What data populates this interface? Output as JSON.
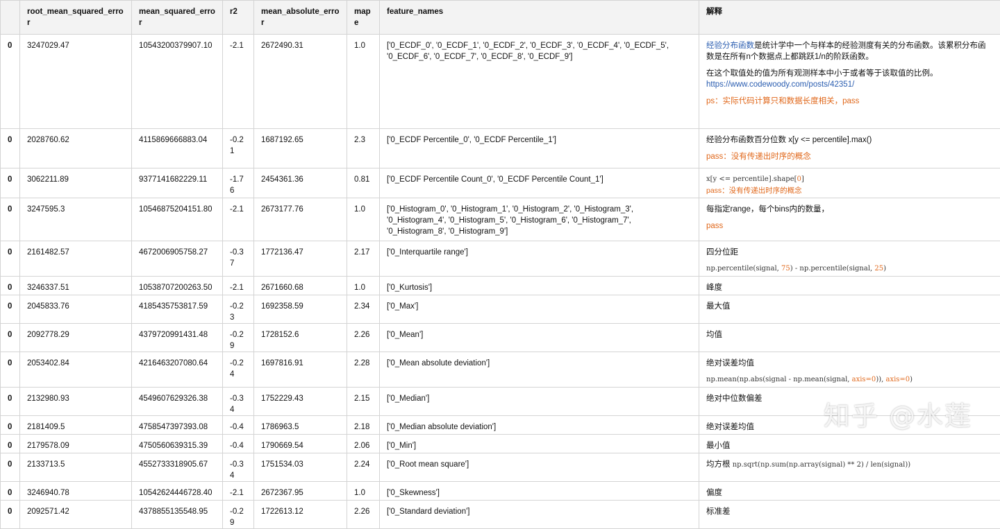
{
  "headers": [
    "",
    "root_mean_squared_error",
    "mean_squared_error",
    "r2",
    "mean_absolute_error",
    "mape",
    "feature_names",
    "解释"
  ],
  "rows": [
    {
      "idx": "0",
      "rmse": "3247029.47",
      "mse": "10543200379907.10",
      "r2": "-2.1",
      "mae": "2672490.31",
      "mape": "1.0",
      "features": "['0_ECDF_0', '0_ECDF_1', '0_ECDF_2', '0_ECDF_3', '0_ECDF_4', '0_ECDF_5', '0_ECDF_6', '0_ECDF_7', '0_ECDF_8', '0_ECDF_9']",
      "exp_link": "经验分布函数",
      "exp_a": "是统计学中一个与样本的经验测度有关的分布函数。该累积分布函数是在所有n个数据点上都跳跃1/n的阶跃函数。",
      "exp_b": "在这个取值处的值为所有观测样本中小于或者等于该取值的比例。",
      "exp_url": "https://www.codewoody.com/posts/42351/",
      "exp_ps": "ps：实际代码计算只和数据长度相关，pass"
    },
    {
      "idx": "0",
      "rmse": "2028760.62",
      "mse": "4115869666883.04",
      "r2": "-0.21",
      "mae": "1687192.65",
      "mape": "2.3",
      "features": "['0_ECDF Percentile_0', '0_ECDF Percentile_1']",
      "exp_a": "经验分布函数百分位数 x[y <= percentile].max()",
      "exp_pass": "pass：没有传递出时序的概念"
    },
    {
      "idx": "0",
      "rmse": "3062211.89",
      "mse": "9377141682229.11",
      "r2": "-1.76",
      "mae": "2454361.36",
      "mape": "0.81",
      "features": "['0_ECDF Percentile Count_0', '0_ECDF Percentile Count_1']",
      "exp_code_a": "x[y <= percentile].shape[",
      "exp_code_num": "0",
      "exp_code_b": "]",
      "exp_pass": "pass：没有传递出时序的概念"
    },
    {
      "idx": "0",
      "rmse": "3247595.3",
      "mse": "10546875204151.80",
      "r2": "-2.1",
      "mae": "2673177.76",
      "mape": "1.0",
      "features": "['0_Histogram_0', '0_Histogram_1', '0_Histogram_2', '0_Histogram_3', '0_Histogram_4', '0_Histogram_5', '0_Histogram_6', '0_Histogram_7', '0_Histogram_8', '0_Histogram_9']",
      "exp_a": "每指定range，每个bins内的数量，",
      "exp_pass": "pass"
    },
    {
      "idx": "0",
      "rmse": "2161482.57",
      "mse": "4672006905758.27",
      "r2": "-0.37",
      "mae": "1772136.47",
      "mape": "2.17",
      "features": "['0_Interquartile range']",
      "exp_a": "四分位距",
      "exp_code_a": "np.percentile(signal, ",
      "exp_code_num": "75",
      "exp_code_b": ") - np.percentile(signal, ",
      "exp_code_num2": "25",
      "exp_code_c": ")"
    },
    {
      "idx": "0",
      "rmse": "3246337.51",
      "mse": "10538707200263.50",
      "r2": "-2.1",
      "mae": "2671660.68",
      "mape": "1.0",
      "features": "['0_Kurtosis']",
      "exp_a": "峰度"
    },
    {
      "idx": "0",
      "rmse": "2045833.76",
      "mse": "4185435753817.59",
      "r2": "-0.23",
      "mae": "1692358.59",
      "mape": "2.34",
      "features": "['0_Max']",
      "exp_a": "最大值"
    },
    {
      "idx": "0",
      "rmse": "2092778.29",
      "mse": "4379720991431.48",
      "r2": "-0.29",
      "mae": "1728152.6",
      "mape": "2.26",
      "features": "['0_Mean']",
      "exp_a": "均值"
    },
    {
      "idx": "0",
      "rmse": "2053402.84",
      "mse": "4216463207080.64",
      "r2": "-0.24",
      "mae": "1697816.91",
      "mape": "2.28",
      "features": "['0_Mean absolute deviation']",
      "exp_a": "绝对误差均值",
      "exp_code_a": "np.mean(np.abs(signal - np.mean(signal, ",
      "exp_code_num": "axis=0",
      "exp_code_b": ")), ",
      "exp_code_num2": "axis=0",
      "exp_code_c": ")"
    },
    {
      "idx": "0",
      "rmse": "2132980.93",
      "mse": "4549607629326.38",
      "r2": "-0.34",
      "mae": "1752229.43",
      "mape": "2.15",
      "features": "['0_Median']",
      "exp_a": "绝对中位数偏差"
    },
    {
      "idx": "0",
      "rmse": "2181409.5",
      "mse": "4758547397393.08",
      "r2": "-0.4",
      "mae": "1786963.5",
      "mape": "2.18",
      "features": "['0_Median absolute deviation']",
      "exp_a": "绝对误差均值"
    },
    {
      "idx": "0",
      "rmse": "2179578.09",
      "mse": "4750560639315.39",
      "r2": "-0.4",
      "mae": "1790669.54",
      "mape": "2.06",
      "features": "['0_Min']",
      "exp_a": "最小值"
    },
    {
      "idx": "0",
      "rmse": "2133713.5",
      "mse": "4552733318905.67",
      "r2": "-0.34",
      "mae": "1751534.03",
      "mape": "2.24",
      "features": "['0_Root mean square']",
      "exp_a": "均方根 ",
      "exp_code_a": "np.sqrt(np.sum(np.array(signal) ** 2) / len(signal))"
    },
    {
      "idx": "0",
      "rmse": "3246940.78",
      "mse": "10542624446728.40",
      "r2": "-2.1",
      "mae": "2672367.95",
      "mape": "1.0",
      "features": "['0_Skewness']",
      "exp_a": "偏度"
    },
    {
      "idx": "0",
      "rmse": "2092571.42",
      "mse": "4378855135548.95",
      "r2": "-0.29",
      "mae": "1722613.12",
      "mape": "2.26",
      "features": "['0_Standard deviation']",
      "exp_a": "标准差"
    }
  ],
  "watermark": "知乎 @水莲"
}
